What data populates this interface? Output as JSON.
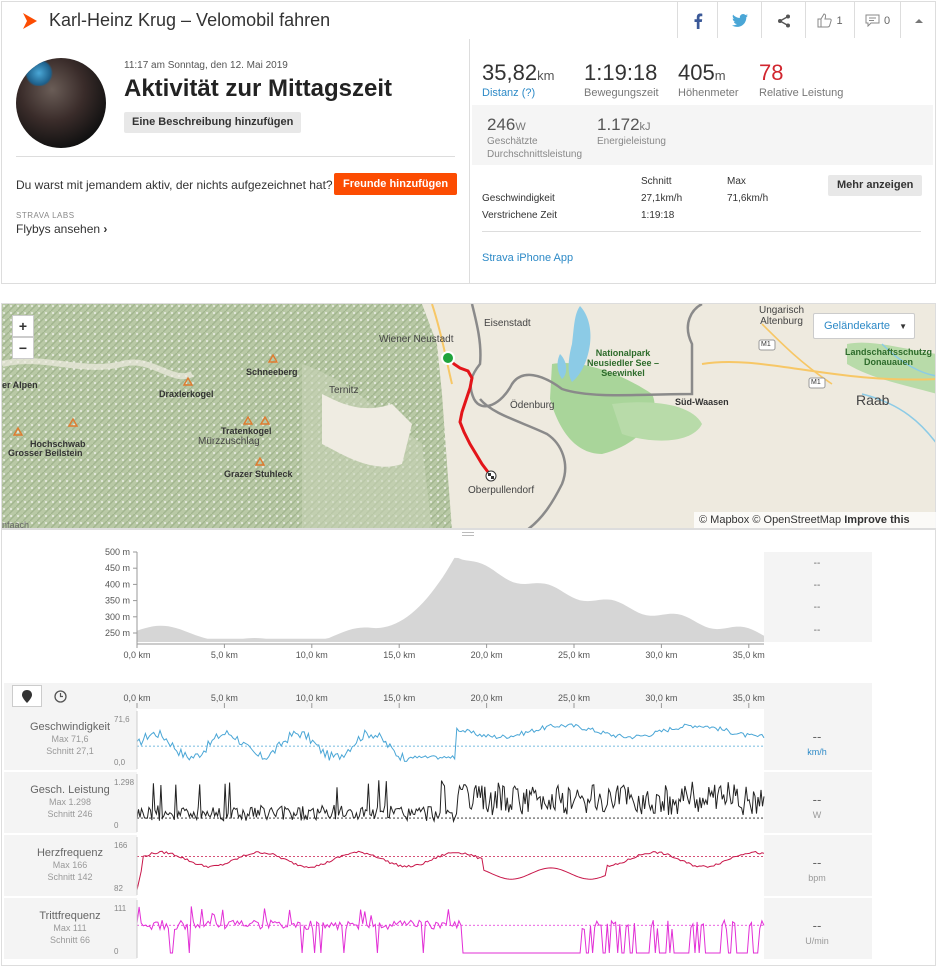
{
  "header": {
    "title": "Karl-Heinz Krug – Velomobil fahren",
    "kudos_count": "1",
    "comments_count": "0"
  },
  "activity": {
    "datetime": "11:17 am Sonntag, den 12. Mai 2019",
    "title": "Aktivität zur Mittagszeit",
    "add_description": "Eine Beschreibung hinzufügen",
    "with_someone_text": "Du warst mit jemandem aktiv, der nichts aufgezeichnet hat?",
    "add_friends": "Freunde hinzufügen",
    "labs": "STRAVA LABS",
    "flybys": "Flybys ansehen"
  },
  "stats": {
    "distance": {
      "value": "35,82",
      "unit": "km",
      "label": "Distanz (?)"
    },
    "moving_time": {
      "value": "1:19:18",
      "unit": "",
      "label": "Bewegungszeit"
    },
    "elevation": {
      "value": "405",
      "unit": "m",
      "label": "Höhenmeter"
    },
    "relative_effort": {
      "value": "78",
      "unit": "",
      "label": "Relative Leistung"
    },
    "power": {
      "value": "246",
      "unit": "W",
      "label1": "Geschätzte",
      "label2": "Durchschnittsleistung"
    },
    "energy": {
      "value": "1.172",
      "unit": "kJ",
      "label": "Energieleistung"
    }
  },
  "details": {
    "col_avg": "Schnitt",
    "col_max": "Max",
    "speed_label": "Geschwindigkeit",
    "speed_avg": "27,1km/h",
    "speed_max": "71,6km/h",
    "elapsed_label": "Verstrichene Zeit",
    "elapsed_value": "1:19:18",
    "more": "Mehr anzeigen",
    "device": "Strava iPhone App"
  },
  "map": {
    "terrain": "Geländekarte",
    "attribution": "© Mapbox © OpenStreetMap",
    "improve": "Improve this map",
    "labels": {
      "ungarisch": "Ungarisch",
      "altenburg": "Altenburg",
      "eisenstadt": "Eisenstadt",
      "wiener_neustadt": "Wiener Neustadt",
      "nationalpark1": "Nationalpark",
      "nationalpark2": "Neusiedler See –",
      "nationalpark3": "Seewinkel",
      "schneeberg": "Schneeberg",
      "draxlerkogel": "Draxlerkogel",
      "ternitz": "Ternitz",
      "oedenburg": "Ödenburg",
      "sued_waasen": "Süd-Waasen",
      "raab": "Raab",
      "landschaft1": "Landschaftsschutzg",
      "landschaft2": "Donauauen",
      "alpen": "er Alpen",
      "hochschwab": "Hochschwab",
      "beilstein": "Grosser Beilstein",
      "tratenkogel": "Tratenkogel",
      "muerzzuschlag": "Mürzzuschlag",
      "stuhleck": "Grazer Stuhleck",
      "oberpullendorf": "Oberpullendorf",
      "m1a": "M1",
      "m1b": "M1",
      "fehaach": "nfaach"
    }
  },
  "elevation_chart": {
    "y_ticks": [
      "500 m",
      "450 m",
      "400 m",
      "350 m",
      "300 m",
      "250 m"
    ],
    "x_ticks": [
      "0,0 km",
      "5,0 km",
      "10,0 km",
      "15,0 km",
      "20,0 km",
      "25,0 km",
      "30,0 km",
      "35,0 km"
    ],
    "dashes": [
      "--",
      "--",
      "--",
      "--"
    ]
  },
  "streams": [
    {
      "name": "Geschwindigkeit",
      "max": "Max 71,6",
      "avg": "Schnitt 27,1",
      "top": "71,6",
      "bottom": "0,0",
      "unit": "km/h",
      "color": "#4aa6d6"
    },
    {
      "name": "Gesch. Leistung",
      "max": "Max 1.298",
      "avg": "Schnitt 246",
      "top": "1.298",
      "bottom": "0",
      "unit": "W",
      "color": "#222222"
    },
    {
      "name": "Herzfrequenz",
      "max": "Max 166",
      "avg": "Schnitt 142",
      "top": "166",
      "bottom": "82",
      "unit": "bpm",
      "color": "#c8174a"
    },
    {
      "name": "Trittfrequenz",
      "max": "Max 111",
      "avg": "Schnitt 66",
      "top": "111",
      "bottom": "0",
      "unit": "U/min",
      "color": "#e22fd6"
    }
  ],
  "stream_dash": "--"
}
